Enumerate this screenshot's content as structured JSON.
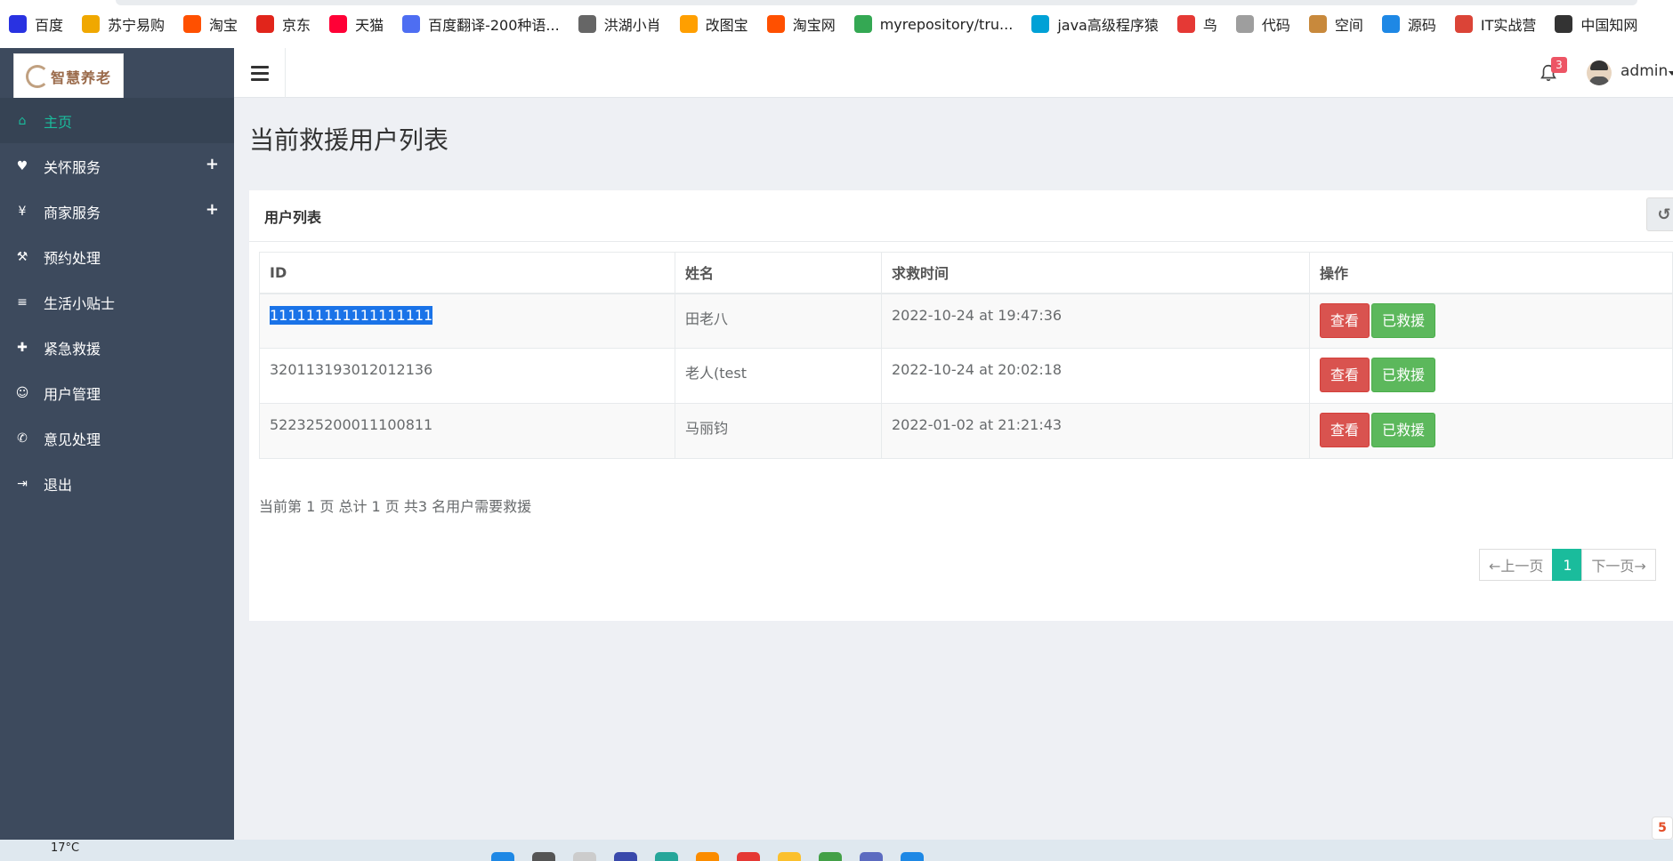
{
  "bookmarks": [
    {
      "label": "百度",
      "icon": "baidu-paw-icon",
      "color": "#2932e1"
    },
    {
      "label": "苏宁易购",
      "icon": "suning-lion-icon",
      "color": "#f0a800"
    },
    {
      "label": "淘宝",
      "icon": "taobao-icon",
      "color": "#ff5000"
    },
    {
      "label": "京东",
      "icon": "jd-icon",
      "color": "#e1251b"
    },
    {
      "label": "天猫",
      "icon": "tmall-icon",
      "color": "#ff0036"
    },
    {
      "label": "百度翻译-200种语...",
      "icon": "translate-icon",
      "color": "#4e6ef2"
    },
    {
      "label": "洪湖小肖",
      "icon": "bird-icon",
      "color": "#666666"
    },
    {
      "label": "改图宝",
      "icon": "image-edit-icon",
      "color": "#ff9f00"
    },
    {
      "label": "淘宝网",
      "icon": "taobao-icon",
      "color": "#ff5000"
    },
    {
      "label": "myrepository/tru...",
      "icon": "chrome-icon",
      "color": "#34a853"
    },
    {
      "label": "java高级程序猿",
      "icon": "bilibili-icon",
      "color": "#00a1d6"
    },
    {
      "label": "鸟",
      "icon": "bird-red-icon",
      "color": "#e53935"
    },
    {
      "label": "代码",
      "icon": "code-icon",
      "color": "#9e9e9e"
    },
    {
      "label": "空间",
      "icon": "space-icon",
      "color": "#c8893c"
    },
    {
      "label": "源码",
      "icon": "fish-icon",
      "color": "#1e88e5"
    },
    {
      "label": "IT实战营",
      "icon": "chrome-red-icon",
      "color": "#db4437"
    },
    {
      "label": "中国知网",
      "icon": "cnki-icon",
      "color": "#333333"
    }
  ],
  "logo": {
    "text": "智慧养老"
  },
  "nav": [
    {
      "label": "主页",
      "icon": "home-icon",
      "glyph": "⌂",
      "active": true,
      "expandable": false
    },
    {
      "label": "关怀服务",
      "icon": "heart-icon",
      "glyph": "♥",
      "active": false,
      "expandable": true
    },
    {
      "label": "商家服务",
      "icon": "yen-icon",
      "glyph": "¥",
      "active": false,
      "expandable": true
    },
    {
      "label": "预约处理",
      "icon": "gavel-icon",
      "glyph": "⚒",
      "active": false,
      "expandable": false
    },
    {
      "label": "生活小贴士",
      "icon": "list-icon",
      "glyph": "≡",
      "active": false,
      "expandable": false
    },
    {
      "label": "紧急救援",
      "icon": "ambulance-icon",
      "glyph": "✚",
      "active": false,
      "expandable": false
    },
    {
      "label": "用户管理",
      "icon": "users-icon",
      "glyph": "☺",
      "active": false,
      "expandable": false
    },
    {
      "label": "意见处理",
      "icon": "bullhorn-icon",
      "glyph": "✆",
      "active": false,
      "expandable": false
    },
    {
      "label": "退出",
      "icon": "sign-in-icon",
      "glyph": "⇥",
      "active": false,
      "expandable": false
    }
  ],
  "nav_plus": "+",
  "header": {
    "notification_count": "3",
    "username": "admin"
  },
  "page": {
    "title": "当前救援用户列表"
  },
  "panel": {
    "title": "用户列表",
    "refresh_glyph": "↺"
  },
  "table": {
    "columns": [
      "ID",
      "姓名",
      "求救时间",
      "操作"
    ],
    "rows": [
      {
        "id": "111111111111111111",
        "name": "田老八",
        "time": "2022-10-24 at 19:47:36",
        "selected": true
      },
      {
        "id": "320113193012012136",
        "name": "老人(test",
        "time": "2022-10-24 at 20:02:18",
        "selected": false
      },
      {
        "id": "522325200011100811",
        "name": "马丽钧",
        "time": "2022-01-02 at 21:21:43",
        "selected": false
      }
    ],
    "view_label": "查看",
    "rescued_label": "已救援"
  },
  "summary": "当前第 1 页 总计 1 页 共3 名用户需要救援",
  "pagination": {
    "prev": "←上一页",
    "current": "1",
    "next": "下一页→"
  },
  "taskbar": {
    "weather": "17°C"
  },
  "colors": {
    "sidebar": "#3d4a5d",
    "accent": "#1abc9c",
    "danger": "#d9534f",
    "success": "#5cb85c",
    "badge": "#ed5565"
  }
}
